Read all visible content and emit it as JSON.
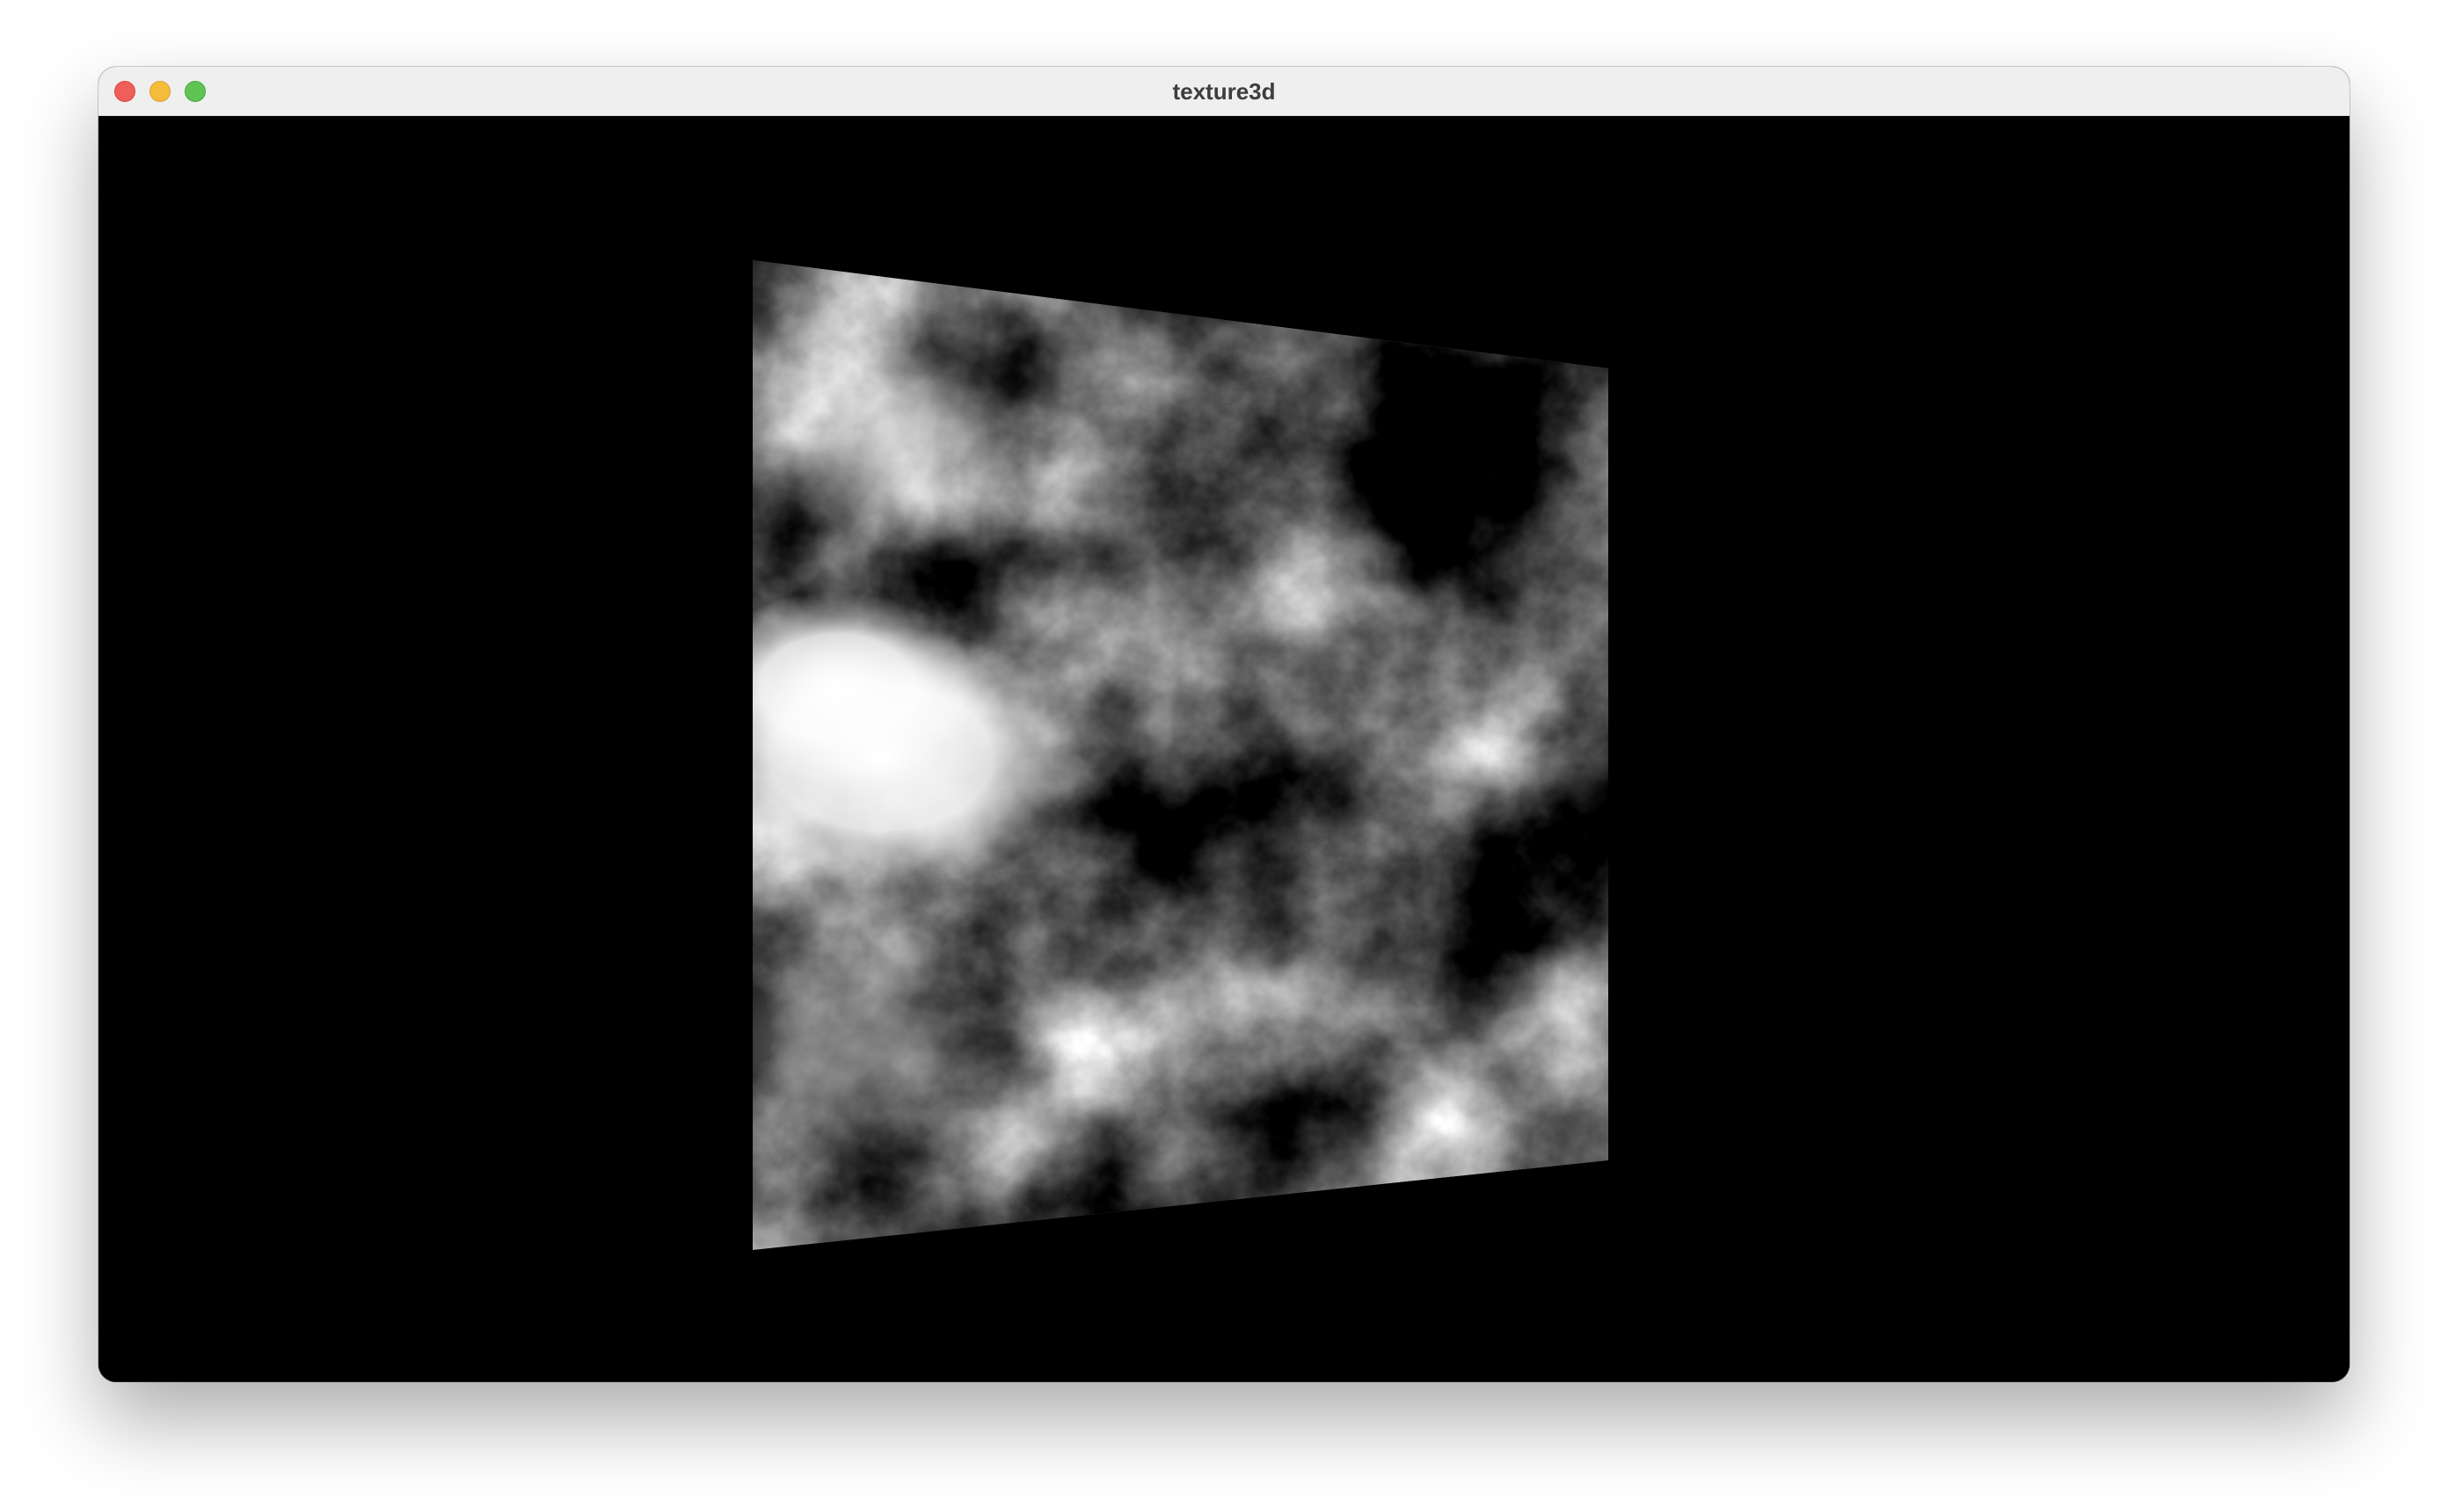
{
  "window": {
    "title": "texture3d"
  },
  "viewport": {
    "background": "#000000",
    "quad_color": "#808080"
  },
  "icons": {
    "close": "close-icon",
    "minimize": "minimize-icon",
    "zoom": "zoom-icon"
  }
}
